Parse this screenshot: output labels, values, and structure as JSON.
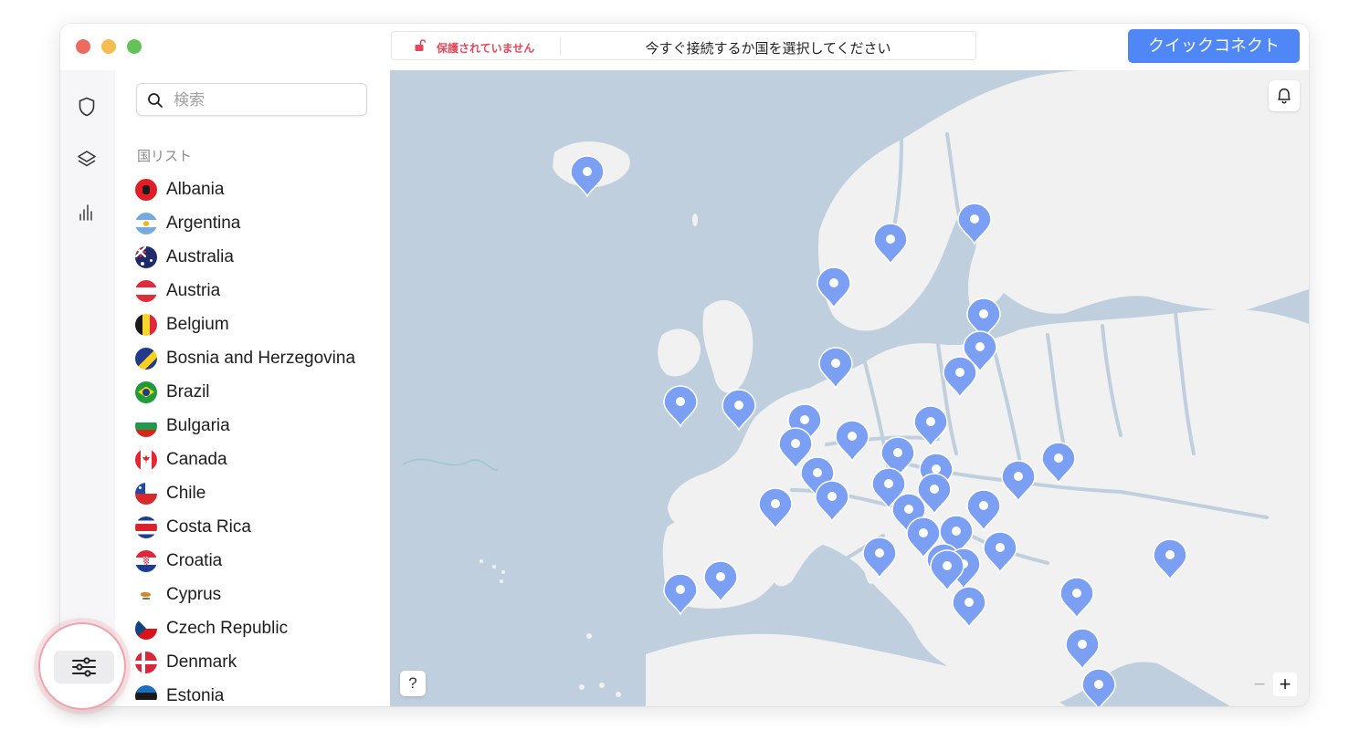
{
  "window": {
    "status": {
      "protection": "保護されていません",
      "message": "今すぐ接続するか国を選択してください"
    },
    "quick_connect_label": "クイックコネクト"
  },
  "rail": {
    "items": [
      {
        "icon": "shield-icon"
      },
      {
        "icon": "layers-icon"
      },
      {
        "icon": "stats-icon"
      }
    ],
    "settings_icon": "sliders-icon"
  },
  "panel": {
    "search": {
      "placeholder": "検索",
      "value": ""
    },
    "section_title": "国リスト",
    "countries": [
      {
        "name": "Albania"
      },
      {
        "name": "Argentina"
      },
      {
        "name": "Australia"
      },
      {
        "name": "Austria"
      },
      {
        "name": "Belgium"
      },
      {
        "name": "Bosnia and Herzegovina"
      },
      {
        "name": "Brazil"
      },
      {
        "name": "Bulgaria"
      },
      {
        "name": "Canada"
      },
      {
        "name": "Chile"
      },
      {
        "name": "Costa Rica"
      },
      {
        "name": "Croatia"
      },
      {
        "name": "Cyprus"
      },
      {
        "name": "Czech Republic"
      },
      {
        "name": "Denmark"
      },
      {
        "name": "Estonia"
      }
    ]
  },
  "map": {
    "help_label": "?",
    "zoom_out_label": "−",
    "zoom_in_label": "+"
  },
  "colors": {
    "accent": "#4f87f6",
    "warning": "#e4485a",
    "sea": "#bfcfde",
    "land": "#f1f1f1",
    "pin": "#7b9ff2"
  }
}
